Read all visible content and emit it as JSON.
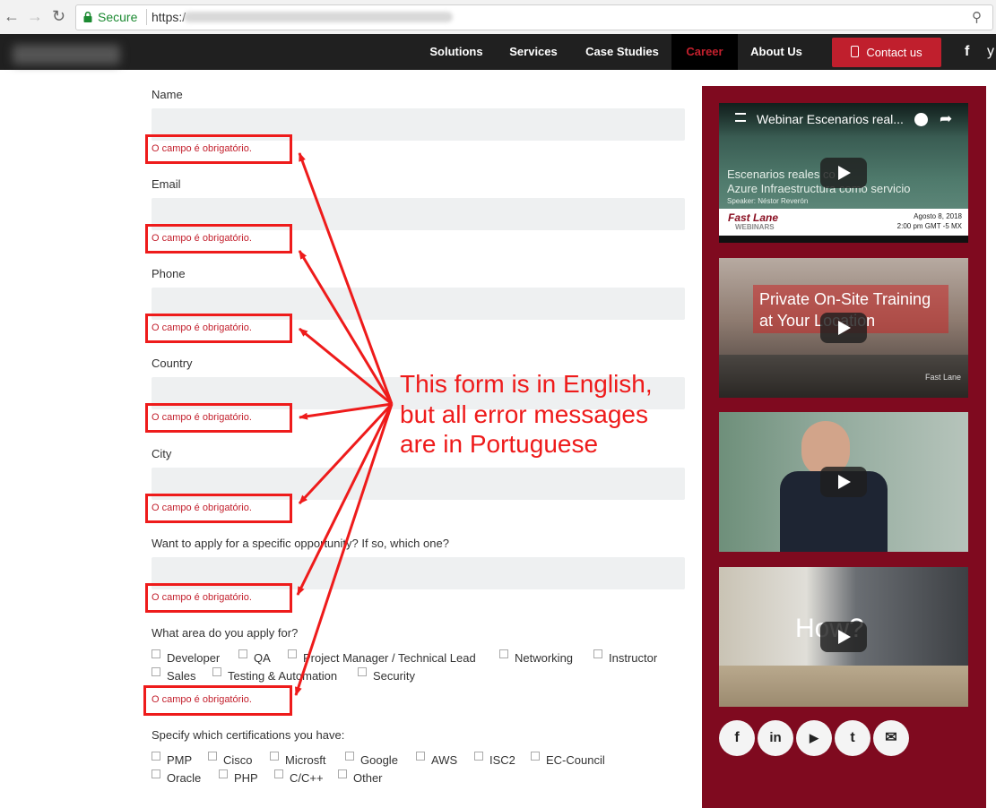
{
  "browser": {
    "secure_label": "Secure",
    "url_prefix": "https:/"
  },
  "nav": {
    "items": [
      "Solutions",
      "Services",
      "Case Studies",
      "Career",
      "About Us"
    ],
    "active": "Career",
    "contact_label": "Contact us",
    "social": [
      "f",
      "y"
    ]
  },
  "form": {
    "fields": [
      {
        "label": "Name",
        "error": "O campo é obrigatório."
      },
      {
        "label": "Email",
        "error": "O campo é obrigatório."
      },
      {
        "label": "Phone",
        "error": "O campo é obrigatório."
      },
      {
        "label": "Country",
        "error": "O campo é obrigatório."
      },
      {
        "label": "City",
        "error": "O campo é obrigatório."
      },
      {
        "label": "Want to apply for a specific opportunity? If so, which one?",
        "error": "O campo é obrigatório."
      }
    ],
    "area_label": "What area do you apply for?",
    "area_options": [
      "Developer",
      "QA",
      "Project Manager / Technical Lead",
      "Networking",
      "Instructor",
      "Sales",
      "Testing & Automation",
      "Security"
    ],
    "area_error": "O campo é obrigatório.",
    "cert_label": "Specify which certifications you have:",
    "cert_options": [
      "PMP",
      "Cisco",
      "Microsft",
      "Google",
      "AWS",
      "ISC2",
      "EC-Council",
      "Oracle",
      "PHP",
      "C/C++",
      "Other"
    ]
  },
  "annotation": {
    "lines": [
      "This form is in English,",
      "but all error messages",
      "are in Portuguese"
    ]
  },
  "videos": [
    {
      "title": "Webinar Escenarios real...",
      "overlay_line1": "Escenarios reales co",
      "overlay_line2": "Azure Infraestructura como servicio",
      "speaker": "Speaker: Néstor Reverón",
      "brand": "Fast Lane",
      "brand_sub": "WEBINARS",
      "date": "Agosto 8, 2018",
      "time": "2:00 pm GMT -5 MX"
    },
    {
      "overlay_line1": "Private On-Site Training",
      "overlay_line2": "at Your Location",
      "watermark": "Fast Lane"
    },
    {},
    {
      "overlay": "How?"
    }
  ],
  "sidebar_social": [
    "f",
    "in",
    "▶",
    "t",
    "✉"
  ],
  "colors": {
    "nav_bg": "#202020",
    "accent_red": "#c01f2d",
    "error_red": "#c3202d",
    "annotation_red": "#ee1b1b",
    "sidebar_bg": "#7f0a1f",
    "field_bg": "#eef0f1"
  }
}
